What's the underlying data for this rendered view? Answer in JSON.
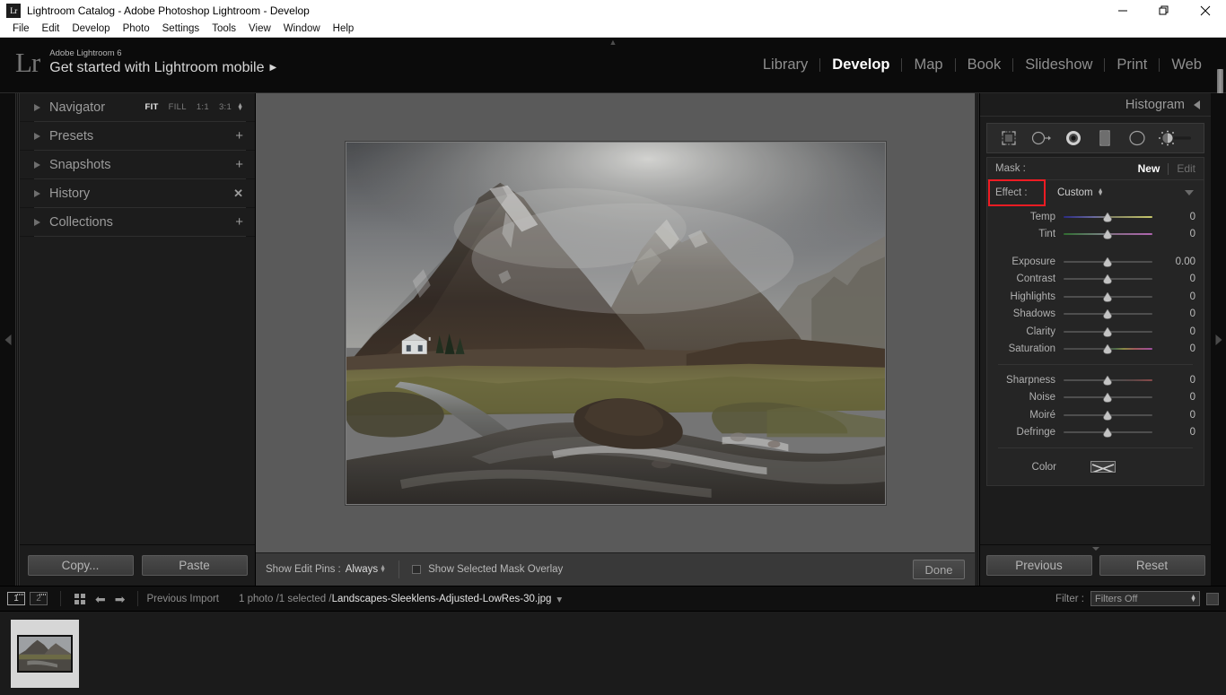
{
  "window": {
    "title": "Lightroom Catalog - Adobe Photoshop Lightroom - Develop",
    "app_icon": "Lr",
    "minimize_icon": "minimize-icon",
    "maximize_icon": "maximize-icon",
    "close_icon": "close-icon"
  },
  "menubar": {
    "items": [
      "File",
      "Edit",
      "Develop",
      "Photo",
      "Settings",
      "Tools",
      "View",
      "Window",
      "Help"
    ]
  },
  "identity": {
    "logo": "Lr",
    "subtitle": "Adobe Lightroom 6",
    "title": "Get started with Lightroom mobile",
    "arrow": "▶"
  },
  "modules": [
    {
      "label": "Library",
      "active": false
    },
    {
      "label": "Develop",
      "active": true
    },
    {
      "label": "Map",
      "active": false
    },
    {
      "label": "Book",
      "active": false
    },
    {
      "label": "Slideshow",
      "active": false
    },
    {
      "label": "Print",
      "active": false
    },
    {
      "label": "Web",
      "active": false
    }
  ],
  "left_panel": {
    "panels": [
      {
        "title": "Navigator",
        "control": "zoom-options"
      },
      {
        "title": "Presets",
        "control": "plus"
      },
      {
        "title": "Snapshots",
        "control": "plus"
      },
      {
        "title": "History",
        "control": "clear"
      },
      {
        "title": "Collections",
        "control": "plus-menu"
      }
    ],
    "zoom_options": [
      {
        "label": "FIT",
        "selected": true
      },
      {
        "label": "FILL",
        "selected": false
      },
      {
        "label": "1:1",
        "selected": false
      },
      {
        "label": "3:1",
        "selected": false
      }
    ],
    "copy_label": "Copy...",
    "paste_label": "Paste"
  },
  "toolbar": {
    "show_edit_pins_label": "Show Edit Pins :",
    "show_edit_pins_value": "Always",
    "mask_overlay_label": "Show Selected Mask Overlay",
    "mask_overlay_checked": false,
    "done_label": "Done"
  },
  "right_panel": {
    "histogram_title": "Histogram",
    "tools": [
      "crop-overlay-icon",
      "spot-removal-icon",
      "red-eye-icon",
      "graduated-filter-icon",
      "radial-filter-icon",
      "adjustment-brush-icon"
    ],
    "mask": {
      "label": "Mask :",
      "new_label": "New",
      "edit_label": "Edit"
    },
    "effect": {
      "label": "Effect :",
      "value": "Custom",
      "highlight_color": "#ee1c23"
    },
    "sliders_group_1": [
      {
        "name": "Temp",
        "value": "0",
        "track": "temp"
      },
      {
        "name": "Tint",
        "value": "0",
        "track": "tint"
      }
    ],
    "sliders_group_2": [
      {
        "name": "Exposure",
        "value": "0.00",
        "track": "plain"
      },
      {
        "name": "Contrast",
        "value": "0",
        "track": "plain"
      },
      {
        "name": "Highlights",
        "value": "0",
        "track": "plain"
      },
      {
        "name": "Shadows",
        "value": "0",
        "track": "plain"
      },
      {
        "name": "Clarity",
        "value": "0",
        "track": "plain"
      },
      {
        "name": "Saturation",
        "value": "0",
        "track": "sat"
      }
    ],
    "sliders_group_3": [
      {
        "name": "Sharpness",
        "value": "0",
        "track": "sharp"
      },
      {
        "name": "Noise",
        "value": "0",
        "track": "plain"
      },
      {
        "name": "Moiré",
        "value": "0",
        "track": "plain"
      },
      {
        "name": "Defringe",
        "value": "0",
        "track": "plain"
      }
    ],
    "color_label": "Color",
    "previous_label": "Previous",
    "reset_label": "Reset"
  },
  "filmstrip_bar": {
    "screen1": "1",
    "screen2": "2",
    "grid_icon": "grid-view-icon",
    "back_icon": "back-arrow-icon",
    "forward_icon": "forward-arrow-icon",
    "source": "Previous Import",
    "count": "1 photo /1 selected /",
    "filename": "Landscapes-Sleeklens-Adjusted-LowRes-30.jpg",
    "filename_caret": "▾",
    "filter_label": "Filter :",
    "filter_value": "Filters Off"
  }
}
